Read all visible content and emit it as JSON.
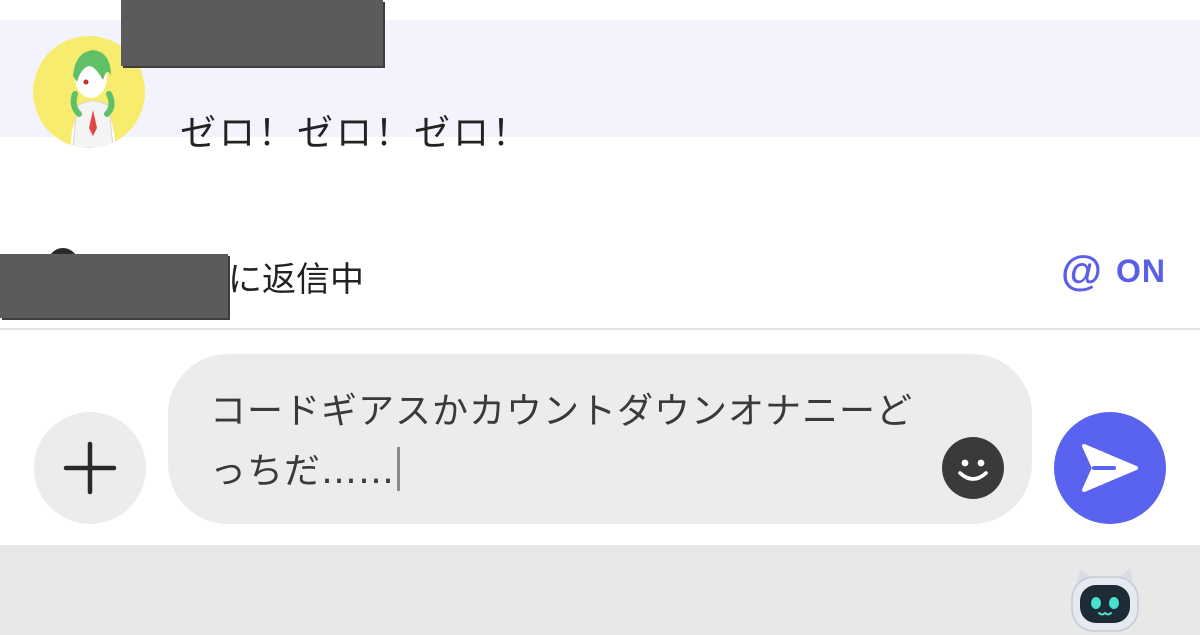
{
  "message": {
    "sender_redacted": true,
    "text": "ゼロ！ゼロ！ゼロ！",
    "avatar_icon": "gardevoir-avatar-icon"
  },
  "reply_bar": {
    "target_redacted": true,
    "label": "に返信中",
    "mention_symbol": "@",
    "mention_state": "ON"
  },
  "composer": {
    "input_value": "コードギアスかカウントダウンオナニーどっちだ……",
    "add_icon": "plus-icon",
    "emoji_icon": "smiley-icon",
    "send_icon": "paper-plane-icon"
  },
  "bottom_panel": {
    "assistant_icon": "cat-bot-icon"
  },
  "colors": {
    "accent": "#5a63ef",
    "message_highlight": "#f3f3fd",
    "input_bg": "#ececec",
    "panel_bg": "#e8e8e8"
  }
}
